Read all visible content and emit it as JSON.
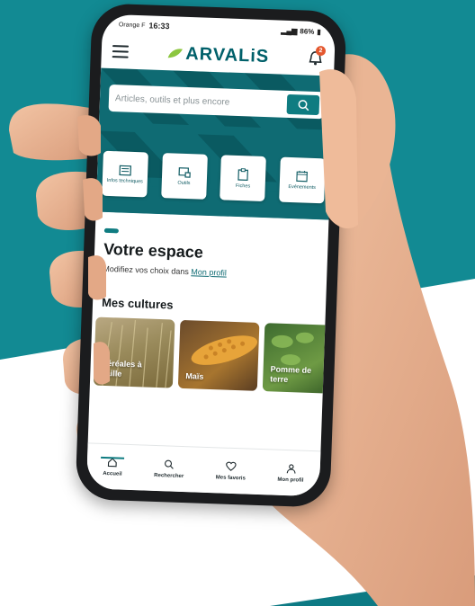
{
  "colors": {
    "brand_teal": "#0f6b73",
    "accent_teal": "#0f7c81",
    "notification": "#e4572e",
    "background_teal": "#128a93"
  },
  "statusbar": {
    "carrier": "Orange F",
    "time": "16:33",
    "battery": "86%"
  },
  "appbar": {
    "menu_icon": "hamburger-icon",
    "logo_text": "ARVALiS",
    "bell_icon": "bell-icon",
    "notification_count": "2"
  },
  "search": {
    "placeholder": "Articles, outils et plus encore",
    "button_icon": "search-icon"
  },
  "quick_links": [
    {
      "label": "Infos techniques",
      "icon": "document-icon"
    },
    {
      "label": "Outils",
      "icon": "tools-icon"
    },
    {
      "label": "Fiches",
      "icon": "clipboard-icon"
    },
    {
      "label": "Evénements",
      "icon": "calendar-icon"
    }
  ],
  "space": {
    "title": "Votre espace",
    "subtitle": "Modifiez vos choix dans",
    "profile_link": "Mon profil"
  },
  "cultures": {
    "heading": "Mes cultures",
    "items": [
      {
        "label": "Céréales à paille"
      },
      {
        "label": "Maïs"
      },
      {
        "label": "Pomme de terre"
      }
    ]
  },
  "tabbar": [
    {
      "label": "Accueil",
      "icon": "home-icon",
      "active": true
    },
    {
      "label": "Rechercher",
      "icon": "search-icon",
      "active": false
    },
    {
      "label": "Mes favoris",
      "icon": "heart-icon",
      "active": false
    },
    {
      "label": "Mon profil",
      "icon": "user-icon",
      "active": false
    }
  ]
}
